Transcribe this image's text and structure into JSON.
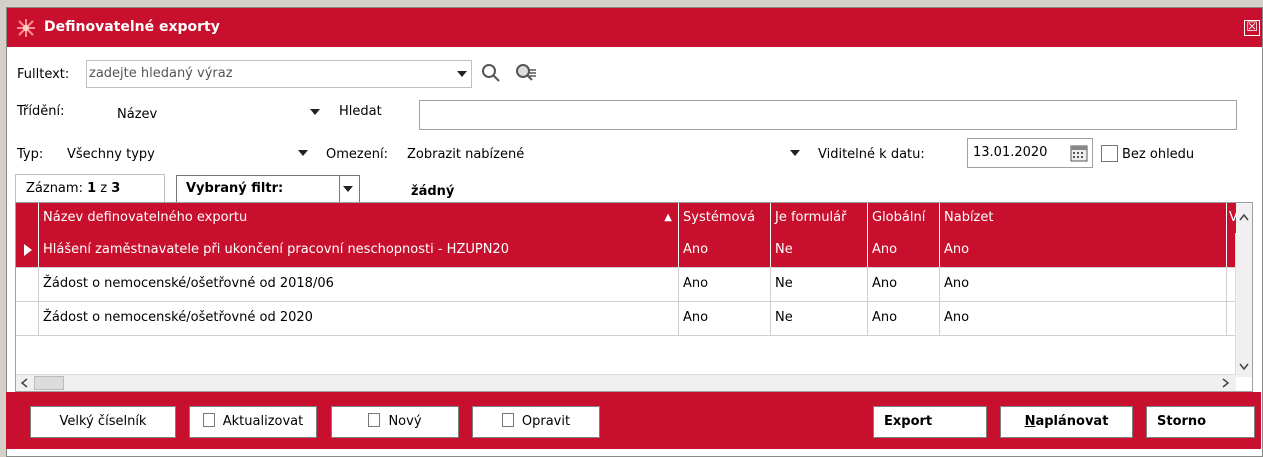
{
  "window": {
    "title": "Definovatelné exporty",
    "close": "☒"
  },
  "fulltext": {
    "label": "Fulltext:",
    "placeholder": "zadejte hledaný výraz"
  },
  "sort": {
    "label": "Třídění:",
    "value": "Název"
  },
  "search": {
    "label": "Hledat",
    "value": ""
  },
  "type": {
    "label": "Typ:",
    "value": "Všechny typy"
  },
  "restriction": {
    "label": "Omezení:",
    "value": "Zobrazit nabízené"
  },
  "visible": {
    "label": "Viditelné k datu:",
    "date": "13.01.2020",
    "checkbox_label": "Bez ohledu"
  },
  "record": {
    "prefix": "Záznam:",
    "current": "1",
    "of": "z",
    "total": "3"
  },
  "filter": {
    "label": "Vybraný filtr:",
    "value": "žádný"
  },
  "table": {
    "columns": [
      "Název definovatelného exportu",
      "Systémová",
      "Je formulář",
      "Globální",
      "Nabízet",
      "V"
    ],
    "rows": [
      [
        "Hlášení zaměstnavatele při ukončení pracovní neschopnosti - HZUPN20",
        "Ano",
        "Ne",
        "Ano",
        "Ano"
      ],
      [
        "Žádost o nemocenské/ošetřovné od 2018/06",
        "Ano",
        "Ne",
        "Ano",
        "Ano"
      ],
      [
        "Žádost o nemocenské/ošetřovné od 2020",
        "Ano",
        "Ne",
        "Ano",
        "Ano"
      ]
    ],
    "selected_row": 0
  },
  "buttons": {
    "big": "Velký číselník",
    "refresh": "Aktualizovat",
    "new": "Nový",
    "edit": "Opravit",
    "export": "Export",
    "schedule_first": "N",
    "schedule_rest": "aplánovat",
    "cancel": "Storno"
  },
  "colors": {
    "accent": "#c8102e"
  }
}
